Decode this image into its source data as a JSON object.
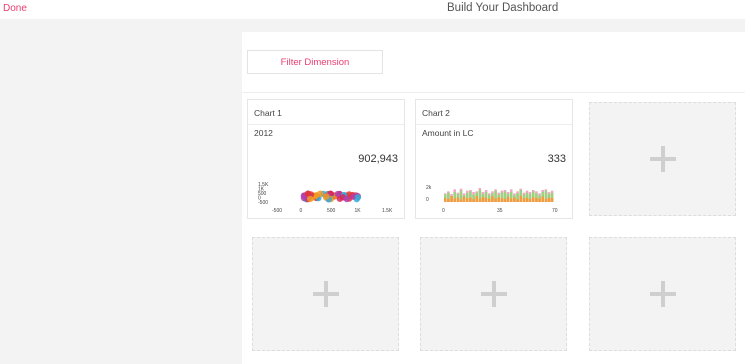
{
  "header": {
    "done_label": "Done",
    "title": "Build Your Dashboard"
  },
  "filter": {
    "label": "Filter Dimension"
  },
  "colors": {
    "accent": "#e83e6f",
    "bubble_colors": [
      "#e8332e",
      "#d6285a",
      "#b23fb0",
      "#f29a1f",
      "#3aa9d8"
    ],
    "bar_orange": "#f59b3c",
    "bar_green": "#9bd17f",
    "bar_pink": "#f1a7c6"
  },
  "charts": [
    {
      "title": "Chart 1",
      "subtitle": "2012",
      "value": "902,943",
      "chart_data": {
        "type": "scatter",
        "x_ticks": [
          "-500",
          "0",
          "500",
          "1K",
          "1.5K"
        ],
        "y_ticks": [
          "1.5K",
          "1K",
          "500",
          "0",
          "-500"
        ],
        "xlim": [
          -500,
          1500
        ],
        "ylim": [
          -500,
          1500
        ],
        "points_x_range": [
          0,
          1000
        ],
        "points_y": 250
      }
    },
    {
      "title": "Chart 2",
      "subtitle": "Amount in LC",
      "value": "333",
      "chart_data": {
        "type": "bar",
        "x_ticks": [
          "0",
          "35",
          "70"
        ],
        "y_ticks": [
          "2k",
          "0"
        ],
        "xlim": [
          0,
          70
        ],
        "ylim": [
          0,
          3000
        ],
        "series": [
          {
            "values": [
              600,
              450,
              900,
              520,
              700,
              380,
              820,
              560,
              640,
              430,
              900,
              510,
              760,
              620,
              480,
              850,
              530,
              700,
              600,
              440,
              780,
              520,
              680,
              390,
              910,
              560,
              640,
              480,
              720,
              600,
              520,
              830,
              470,
              660,
              590
            ]
          },
          {
            "values": [
              1100,
              1400,
              900,
              1500,
              1200,
              1700,
              1000,
              1300,
              1600,
              1100,
              1400,
              1800,
              1200,
              1500,
              1000,
              1300,
              1700,
              1100,
              1400,
              1600,
              1200,
              1500,
              1000,
              1300,
              1800,
              1100,
              1400,
              1200,
              1600,
              1300,
              1000,
              1500,
              1700,
              1200,
              1400
            ]
          },
          {
            "values": [
              1300,
              1600,
              1200,
              1900,
              1400,
              2000,
              1300,
              1700,
              1800,
              1500,
              1600,
              2100,
              1500,
              1800,
              1300,
              1600,
              1900,
              1400,
              1700,
              1800,
              1500,
              1900,
              1300,
              1600,
              2000,
              1400,
              1700,
              1500,
              1800,
              1600,
              1300,
              1800,
              1900,
              1500,
              1700
            ]
          }
        ]
      }
    }
  ],
  "empty_slots": [
    {
      "label": "add-chart"
    },
    {
      "label": "add-chart"
    },
    {
      "label": "add-chart"
    },
    {
      "label": "add-chart"
    }
  ]
}
